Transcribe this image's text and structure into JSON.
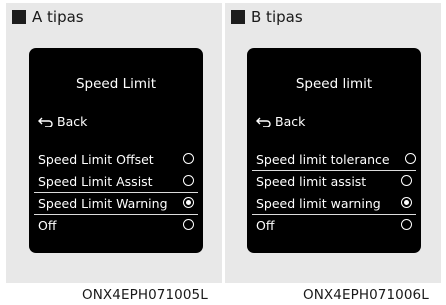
{
  "panels": [
    {
      "header": "A tipas",
      "title": "Speed Limit",
      "back_label": "Back",
      "options": [
        {
          "label": "Speed Limit Offset",
          "selected": false
        },
        {
          "label": "Speed Limit Assist",
          "selected": false
        },
        {
          "label": "Speed Limit Warning",
          "selected": true
        },
        {
          "label": "Off",
          "selected": false
        }
      ],
      "caption": "ONX4EPH071005L"
    },
    {
      "header": "B tipas",
      "title": "Speed limit",
      "back_label": "Back",
      "options": [
        {
          "label": "Speed limit tolerance",
          "selected": false
        },
        {
          "label": "Speed limit assist",
          "selected": false
        },
        {
          "label": "Speed limit warning",
          "selected": true
        },
        {
          "label": "Off",
          "selected": false
        }
      ],
      "caption": "ONX4EPH071006L"
    }
  ],
  "icons": {
    "bullet": "square-bullet-icon",
    "back": "back-arrow-icon",
    "radio": "radio-button-icon"
  },
  "colors": {
    "panel_bg": "#e8e8e8",
    "screen_bg": "#000000",
    "screen_text": "#ffffff"
  }
}
